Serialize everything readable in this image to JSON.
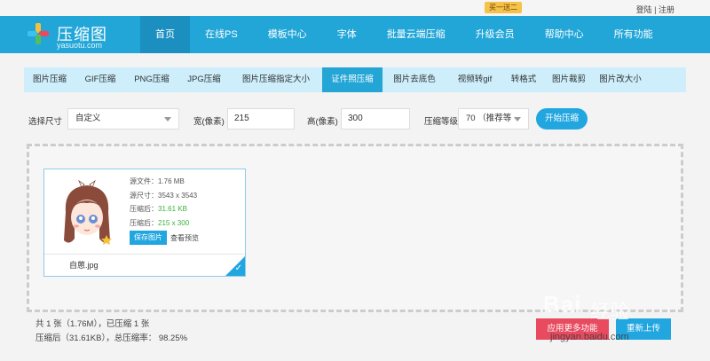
{
  "topbar": {
    "login": "登陆",
    "sep": "|",
    "register": "注册"
  },
  "header": {
    "logo_title": "压缩图",
    "logo_sub": "yasuotu.com",
    "nav": [
      "首页",
      "在线PS",
      "模板中心",
      "字体",
      "批量云端压缩",
      "升级会员",
      "帮助中心",
      "所有功能"
    ],
    "active_index": 0,
    "promo_badge": "买一送二"
  },
  "tabs": {
    "items": [
      "图片压缩",
      "GIF压缩",
      "PNG压缩",
      "JPG压缩",
      "图片压缩指定大小",
      "证件照压缩",
      "图片去底色",
      "视频转gif",
      "转格式",
      "图片裁剪",
      "图片改大小"
    ],
    "active_index": 5
  },
  "options": {
    "size_label": "选择尺寸",
    "size_value": "自定义",
    "width_label": "宽(像素)",
    "width_value": "215",
    "height_label": "高(像素)",
    "height_value": "300",
    "level_label": "压缩等级",
    "level_value": "70 （推荐等",
    "start_button": "开始压缩"
  },
  "file_card": {
    "source_size": "源文件：1.76 MB",
    "source_dims": "源尺寸：3543 x 3543",
    "compressed_label": "压缩后：",
    "compressed_size": "31.61 KB",
    "compressed_dims": "215 x 300",
    "save_button": "保存图片",
    "preview_link": "查看预览",
    "filename": "自蒽.jpg"
  },
  "summary": {
    "line1": "共 1 张（1.76M），已压缩 1 张",
    "line2": "压缩后（31.61KB），总压缩率： 98.25%"
  },
  "actions": {
    "more_features": "应用更多功能",
    "reupload": "重新上传"
  },
  "watermark": {
    "brand": "Bai",
    "brand2": "经验",
    "url": "jingyan.baidu.com"
  },
  "colors": {
    "header_blue": "#22a6d8",
    "tab_bg": "#cdeefa",
    "green": "#3cb23c",
    "red": "#e84a5f"
  }
}
